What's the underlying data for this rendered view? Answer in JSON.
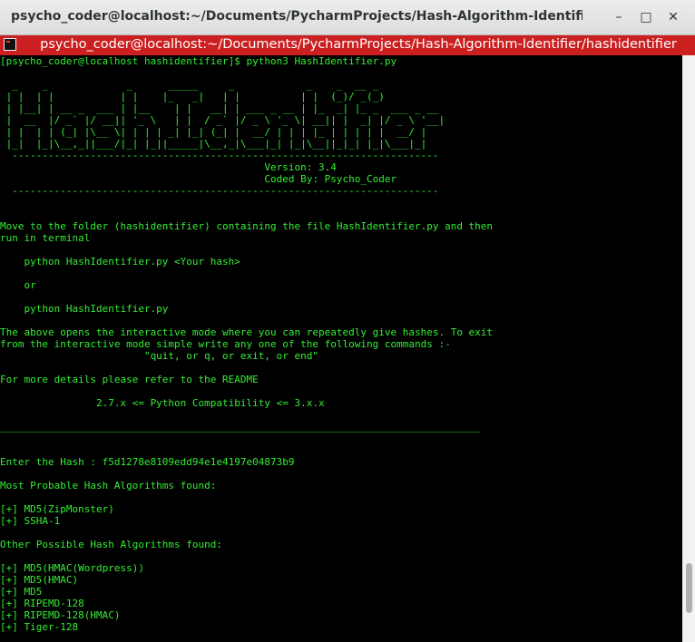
{
  "window": {
    "title": "psycho_coder@localhost:~/Documents/PycharmProjects/Hash-Algorithm-Identifier/hashide...",
    "minimize_glyph": "–",
    "maximize_glyph": "□",
    "close_glyph": "✕"
  },
  "tab": {
    "title": "psycho_coder@localhost:~/Documents/PycharmProjects/Hash-Algorithm-Identifier/hashidentifier",
    "icon": "terminal-icon"
  },
  "terminal": {
    "lines": [
      "[psycho_coder@localhost hashidentifier]$ python3 HashIdentifier.py",
      "",
      "  _    _             _      _____     _            _    _  __ _",
      " | |  | |           | |    |_   _|   | |          | |  (_)/ _(_)",
      " | |__| | __ _  ___ | |__    | |   __| | ___ _ __ | |_  _| |_ _  ___ _ __",
      " |  __  |/ _` |/ __|| '_ \\   | |  / _` |/ _ \\ '_ \\| __|| |  _| |/ _ \\ '__|",
      " | |  | | (_| |\\__ \\| | | | _| |_| (_| |  __/ | | | |_ | | | | |  __/ |",
      " |_|  |_|\\__,_||___/|_| |_||_____|\\__,_|\\___|_| |_|\\__||_|_| |_|\\___|_|",
      "  -----------------------------------------------------------------------",
      "                                            Version: 3.4",
      "                                            Coded By: Psycho_Coder",
      "  -----------------------------------------------------------------------",
      "",
      "",
      "Move to the folder (hashidentifier) containing the file HashIdentifier.py and then",
      "run in terminal",
      "",
      "    python HashIdentifier.py <Your hash>",
      "",
      "    or",
      "",
      "    python HashIdentifier.py",
      "",
      "The above opens the interactive mode where you can repeatedly give hashes. To exit",
      "from the interactive mode simple write any one of the following commands :-",
      "                        \"quit, or q, or exit, or end\"",
      "",
      "For more details please refer to the README",
      "",
      "                2.7.x <= Python Compatibility <= 3.x.x",
      "",
      "________________________________________________________________________________",
      "",
      "",
      "Enter the Hash : f5d1278e8109edd94e1e4197e04873b9",
      "",
      "Most Probable Hash Algorithms found:",
      "",
      "[+] MD5(ZipMonster)",
      "[+] SSHA-1",
      "",
      "Other Possible Hash Algorithms found:",
      "",
      "[+] MD5(HMAC(Wordpress))",
      "[+] MD5(HMAC)",
      "[+] MD5",
      "[+] RIPEMD-128",
      "[+] RIPEMD-128(HMAC)",
      "[+] Tiger-128"
    ]
  },
  "colors": {
    "terminal_text": "#33ee33",
    "terminal_bg": "#000000",
    "tab_bar": "#cc1f1f",
    "title_bar": "#e5e5e5"
  }
}
